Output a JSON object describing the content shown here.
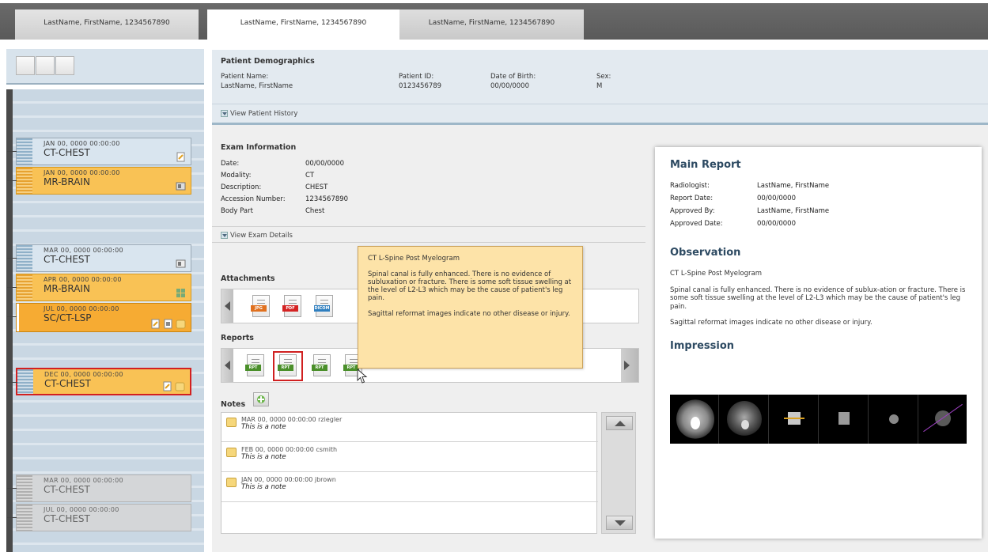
{
  "tabs": [
    {
      "label": "LastName, FirstName, 1234567890"
    },
    {
      "label": "LastName, FirstName, 1234567890"
    },
    {
      "label": "LastName, FirstName, 1234567890"
    }
  ],
  "timeline": {
    "cards": [
      {
        "date": "JAN 00, 0000  00:00:00",
        "name": "CT-CHEST"
      },
      {
        "date": "JAN 00, 0000    00:00:00",
        "name": "MR-BRAIN"
      },
      {
        "date": "MAR 00, 0000  00:00:00",
        "name": "CT-CHEST"
      },
      {
        "date": "APR 00, 0000  00:00:00",
        "name": "MR-BRAIN"
      },
      {
        "date": "JUL 00, 0000  00:00:00",
        "name": "SC/CT-LSP"
      },
      {
        "date": "DEC 00, 0000  00:00:00",
        "name": "CT-CHEST"
      },
      {
        "date": "MAR 00, 0000  00:00:00",
        "name": "CT-CHEST"
      },
      {
        "date": "JUL 00, 0000  00:00:00",
        "name": "CT-CHEST"
      }
    ]
  },
  "demographics": {
    "title": "Patient Demographics",
    "name_label": "Patient Name:",
    "name_value": "LastName, FirstName",
    "id_label": "Patient ID:",
    "id_value": "0123456789",
    "dob_label": "Date of Birth:",
    "dob_value": "00/00/0000",
    "sex_label": "Sex:",
    "sex_value": "M",
    "history_link": "View Patient History"
  },
  "exam": {
    "title": "Exam Information",
    "rows": [
      {
        "label": "Date:",
        "value": "00/00/0000"
      },
      {
        "label": "Modality:",
        "value": "CT"
      },
      {
        "label": "Description:",
        "value": "CHEST"
      },
      {
        "label": "Accession Number:",
        "value": "1234567890"
      },
      {
        "label": "Body Part",
        "value": "Chest"
      }
    ],
    "details_link": "View Exam Details"
  },
  "attachments": {
    "title": "Attachments",
    "items": [
      "JPG",
      "PDF",
      "DICOM"
    ]
  },
  "reports": {
    "title": "Reports",
    "items": [
      "RPT",
      "RPT",
      "RPT",
      "RPT"
    ]
  },
  "notes": {
    "title": "Notes",
    "items": [
      {
        "meta": "MAR 00, 0000  00:00:00  rziegler",
        "text": "This is a note"
      },
      {
        "meta": "FEB 00, 0000  00:00:00  csmith",
        "text": "This is a note"
      },
      {
        "meta": "JAN 00, 0000  00:00:00  jbrown",
        "text": "This is a note"
      }
    ]
  },
  "tooltip": {
    "title": "CT L-Spine Post Myelogram",
    "p1": "Spinal canal is fully enhanced. There is no evidence of subluxation or fracture. There is some soft tissue swelling at the level of L2-L3 which may be the cause of patient's leg pain.",
    "p2": "Sagittal reformat images indicate no other disease or injury."
  },
  "report": {
    "title": "Main Report",
    "rows": [
      {
        "label": "Radiologist:",
        "value": "LastName, FirstName"
      },
      {
        "label": "Report Date:",
        "value": "00/00/0000"
      },
      {
        "label": "Approved By:",
        "value": "LastName, FirstName"
      },
      {
        "label": "Approved Date:",
        "value": "00/00/0000"
      }
    ],
    "observation_title": "Observation",
    "observation_head": "CT L-Spine Post Myelogram",
    "observation_p1": "Spinal canal is fully enhanced. There is no evidence of sublux-ation or fracture. There is some soft tissue swelling at the level of L2-L3 which may be the cause of patient's leg pain.",
    "observation_p2": "Sagittal reformat images indicate no other disease or injury.",
    "impression_title": "Impression"
  },
  "colors": {
    "accent": "#2d4a62",
    "selected_card": "#f6ab33",
    "highlight_border": "#d22020",
    "tooltip_bg": "#fde3a8"
  }
}
